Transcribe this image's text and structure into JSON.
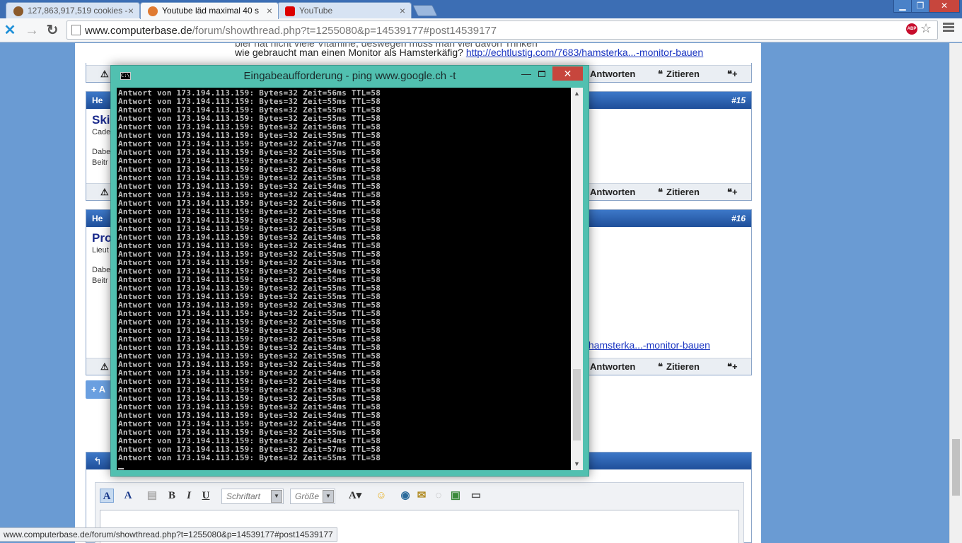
{
  "browser": {
    "tabs": [
      {
        "label": "127,863,917,519 cookies - ",
        "favicon": "cookie-icon"
      },
      {
        "label": "Youtube läd maximal 40 s",
        "favicon": "computerbase-icon"
      },
      {
        "label": "YouTube",
        "favicon": "youtube-icon"
      }
    ],
    "window_controls": {
      "minimize": "▁",
      "restore": "❐",
      "close": "✕"
    },
    "url_host": "www.computerbase.de",
    "url_path": "/forum/showthread.php?t=1255080&p=14539177#post14539177",
    "abp_label": "ABP",
    "status_url": "www.computerbase.de/forum/showthread.php?t=1255080&p=14539177#post14539177"
  },
  "forum": {
    "post_prev": {
      "text_line1": "bier hat nicht viele Vitamine, deswegen muss man viel davon Trinken",
      "text_line2_prefix": "wie gebraucht man einen Monitor als Hamsterkäfig? ",
      "link": "http://echtlustig.com/7683/hamsterka...-monitor-bauen"
    },
    "post_15": {
      "header": "He",
      "number": "#15",
      "username": "Ski",
      "meta1": "Cade",
      "meta2": "Dabe",
      "meta3": "Beitr"
    },
    "post_16": {
      "header": "He",
      "number": "#16",
      "username": "Pro",
      "meta1": "Lieut",
      "meta2": "Dabe",
      "meta3": "Beitr",
      "link": "/hamsterka...-monitor-bauen"
    },
    "actions": {
      "reply": "Antworten",
      "quote": "Zitieren"
    },
    "reply_button": "+ A",
    "editor": {
      "font_select": "Schriftart",
      "size_select": "Größe",
      "bold": "B",
      "italic": "I",
      "underline": "U"
    }
  },
  "cmd": {
    "title": "Eingabeaufforderung - ping  www.google.ch -t",
    "icon_text": "C:\\",
    "minimize": "—",
    "close": "✕",
    "lines": [
      "Antwort von 173.194.113.159: Bytes=32 Zeit=56ms TTL=58",
      "Antwort von 173.194.113.159: Bytes=32 Zeit=55ms TTL=58",
      "Antwort von 173.194.113.159: Bytes=32 Zeit=55ms TTL=58",
      "Antwort von 173.194.113.159: Bytes=32 Zeit=55ms TTL=58",
      "Antwort von 173.194.113.159: Bytes=32 Zeit=56ms TTL=58",
      "Antwort von 173.194.113.159: Bytes=32 Zeit=55ms TTL=58",
      "Antwort von 173.194.113.159: Bytes=32 Zeit=57ms TTL=58",
      "Antwort von 173.194.113.159: Bytes=32 Zeit=55ms TTL=58",
      "Antwort von 173.194.113.159: Bytes=32 Zeit=55ms TTL=58",
      "Antwort von 173.194.113.159: Bytes=32 Zeit=56ms TTL=58",
      "Antwort von 173.194.113.159: Bytes=32 Zeit=55ms TTL=58",
      "Antwort von 173.194.113.159: Bytes=32 Zeit=54ms TTL=58",
      "Antwort von 173.194.113.159: Bytes=32 Zeit=54ms TTL=58",
      "Antwort von 173.194.113.159: Bytes=32 Zeit=56ms TTL=58",
      "Antwort von 173.194.113.159: Bytes=32 Zeit=55ms TTL=58",
      "Antwort von 173.194.113.159: Bytes=32 Zeit=55ms TTL=58",
      "Antwort von 173.194.113.159: Bytes=32 Zeit=55ms TTL=58",
      "Antwort von 173.194.113.159: Bytes=32 Zeit=54ms TTL=58",
      "Antwort von 173.194.113.159: Bytes=32 Zeit=54ms TTL=58",
      "Antwort von 173.194.113.159: Bytes=32 Zeit=55ms TTL=58",
      "Antwort von 173.194.113.159: Bytes=32 Zeit=53ms TTL=58",
      "Antwort von 173.194.113.159: Bytes=32 Zeit=54ms TTL=58",
      "Antwort von 173.194.113.159: Bytes=32 Zeit=55ms TTL=58",
      "Antwort von 173.194.113.159: Bytes=32 Zeit=55ms TTL=58",
      "Antwort von 173.194.113.159: Bytes=32 Zeit=55ms TTL=58",
      "Antwort von 173.194.113.159: Bytes=32 Zeit=53ms TTL=58",
      "Antwort von 173.194.113.159: Bytes=32 Zeit=55ms TTL=58",
      "Antwort von 173.194.113.159: Bytes=32 Zeit=55ms TTL=58",
      "Antwort von 173.194.113.159: Bytes=32 Zeit=55ms TTL=58",
      "Antwort von 173.194.113.159: Bytes=32 Zeit=55ms TTL=58",
      "Antwort von 173.194.113.159: Bytes=32 Zeit=54ms TTL=58",
      "Antwort von 173.194.113.159: Bytes=32 Zeit=55ms TTL=58",
      "Antwort von 173.194.113.159: Bytes=32 Zeit=54ms TTL=58",
      "Antwort von 173.194.113.159: Bytes=32 Zeit=54ms TTL=58",
      "Antwort von 173.194.113.159: Bytes=32 Zeit=54ms TTL=58",
      "Antwort von 173.194.113.159: Bytes=32 Zeit=53ms TTL=58",
      "Antwort von 173.194.113.159: Bytes=32 Zeit=55ms TTL=58",
      "Antwort von 173.194.113.159: Bytes=32 Zeit=54ms TTL=58",
      "Antwort von 173.194.113.159: Bytes=32 Zeit=54ms TTL=58",
      "Antwort von 173.194.113.159: Bytes=32 Zeit=54ms TTL=58",
      "Antwort von 173.194.113.159: Bytes=32 Zeit=55ms TTL=58",
      "Antwort von 173.194.113.159: Bytes=32 Zeit=54ms TTL=58",
      "Antwort von 173.194.113.159: Bytes=32 Zeit=57ms TTL=58",
      "Antwort von 173.194.113.159: Bytes=32 Zeit=55ms TTL=58"
    ]
  }
}
